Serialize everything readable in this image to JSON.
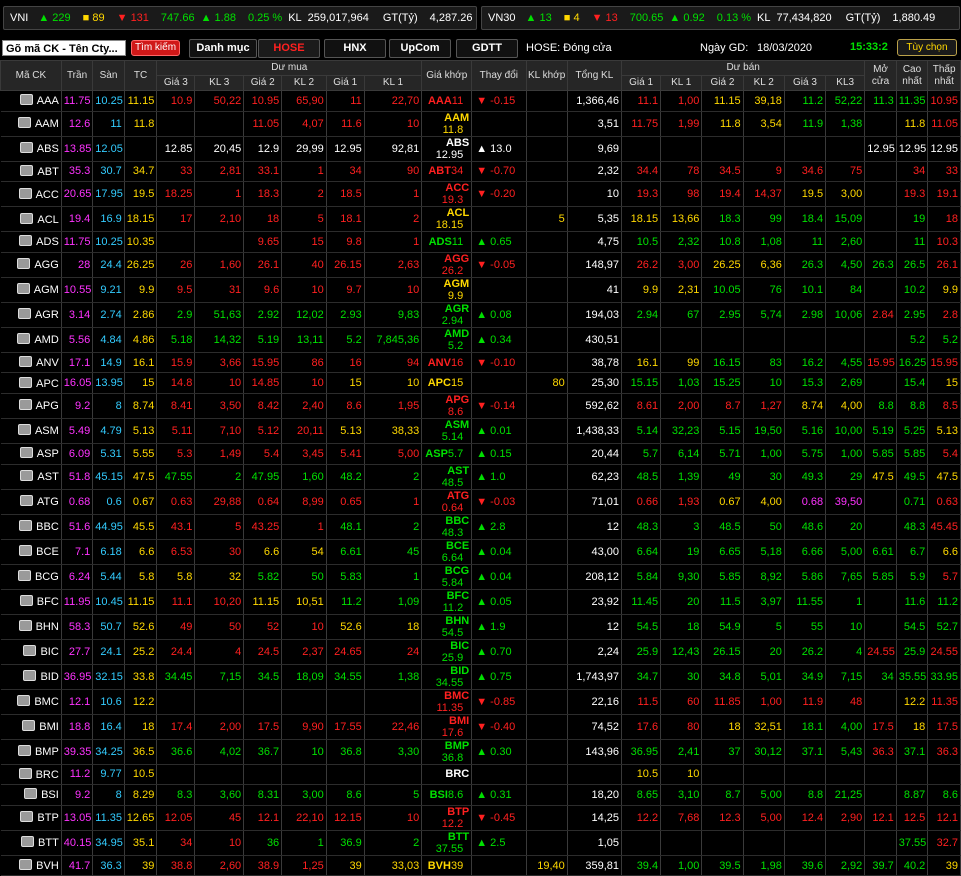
{
  "indices": [
    {
      "name": "VNI",
      "up": "229",
      "ref": "89",
      "down": "131",
      "value": "747.66",
      "change": "1.88",
      "pct": "0.25 %",
      "kl_label": "KL",
      "kl": "259,017,964",
      "gt_label": "GT(Tỷ)",
      "gt": "4,287.26"
    },
    {
      "name": "VN30",
      "up": "13",
      "ref": "4",
      "down": "13",
      "value": "700.65",
      "change": "0.92",
      "pct": "0.13 %",
      "kl_label": "KL",
      "kl": "77,434,820",
      "gt_label": "GT(Tỷ)",
      "gt": "1,880.49"
    }
  ],
  "toolbar": {
    "search_placeholder": "Gõ mã CK - Tên Cty...",
    "search_button": "Tìm kiếm",
    "tabs": [
      "Danh mục",
      "HOSE",
      "HNX",
      "UpCom",
      "GDTT"
    ],
    "active_tab": "HOSE",
    "market_status": "HOSE:  Đóng cửa",
    "date_label": "Ngày GD:",
    "date": "18/03/2020",
    "clock": "15:33:2",
    "custom_button": "Tùy chọn"
  },
  "headers": {
    "symbol": "Mã CK",
    "ceil": "Trần",
    "floor": "Sàn",
    "ref": "TC",
    "buy_group": "Dư mua",
    "match_group": "Giá khớp",
    "change": "Thay đổi",
    "match_vol": "KL khớp",
    "total_vol": "Tổng KL",
    "sell_group": "Dư bán",
    "open": "Mở cửa",
    "high": "Cao nhất",
    "low": "Thấp nhất",
    "buy_cols": [
      "Giá 3",
      "KL 3",
      "Giá 2",
      "KL 2",
      "Giá 1",
      "KL 1"
    ],
    "sell_cols": [
      "Giá 1",
      "KL 1",
      "Giá 2",
      "KL 2",
      "Giá 3",
      "KL3"
    ]
  },
  "colors": {
    "ceil": "#ff33ff",
    "floor": "#33ccff",
    "ref": "#ffd800",
    "up": "#00e000",
    "down": "#ff2020",
    "header_bg": "#262626"
  },
  "rows": [
    [
      "AAA",
      "11.75",
      "10.25",
      "11.15",
      "10.9",
      "50,22",
      "10.95",
      "65,90",
      "11",
      "22,70",
      "11",
      "-0.15",
      "",
      "1,366,46",
      "11.1",
      "1,00",
      "11.15",
      "39,18",
      "11.2",
      "52,22",
      "11.3",
      "11.35",
      "10.95"
    ],
    [
      "AAM",
      "12.6",
      "11",
      "11.8",
      "",
      "",
      "11.05",
      "4,07",
      "11.6",
      "10",
      "11.8",
      "",
      "",
      "3,51",
      "11.75",
      "1,99",
      "11.8",
      "3,54",
      "11.9",
      "1,38",
      "",
      "11.8",
      "11.05"
    ],
    [
      "ABS",
      "13.85",
      "12.05",
      "",
      "12.85",
      "20,45",
      "12.9",
      "29,99",
      "12.95",
      "92,81",
      "12.95",
      "13.0",
      "",
      "9,69",
      "",
      "",
      "",
      "",
      "",
      "",
      "12.95",
      "12.95",
      "12.95"
    ],
    [
      "ABT",
      "35.3",
      "30.7",
      "34.7",
      "33",
      "2,81",
      "33.1",
      "1",
      "34",
      "90",
      "34",
      "-0.70",
      "",
      "2,32",
      "34.4",
      "78",
      "34.5",
      "9",
      "34.6",
      "75",
      "",
      "34",
      "33"
    ],
    [
      "ACC",
      "20.65",
      "17.95",
      "19.5",
      "18.25",
      "1",
      "18.3",
      "2",
      "18.5",
      "1",
      "19.3",
      "-0.20",
      "",
      "10",
      "19.3",
      "98",
      "19.4",
      "14,37",
      "19.5",
      "3,00",
      "",
      "19.3",
      "19.1"
    ],
    [
      "ACL",
      "19.4",
      "16.9",
      "18.15",
      "17",
      "2,10",
      "18",
      "5",
      "18.1",
      "2",
      "18.15",
      "",
      "5",
      "5,35",
      "18.15",
      "13,66",
      "18.3",
      "99",
      "18.4",
      "15,09",
      "",
      "19",
      "18"
    ],
    [
      "ADS",
      "11.75",
      "10.25",
      "10.35",
      "",
      "",
      "9.65",
      "15",
      "9.8",
      "1",
      "11",
      "0.65",
      "",
      "4,75",
      "10.5",
      "2,32",
      "10.8",
      "1,08",
      "11",
      "2,60",
      "",
      "11",
      "10.3"
    ],
    [
      "AGG",
      "28",
      "24.4",
      "26.25",
      "26",
      "1,60",
      "26.1",
      "40",
      "26.15",
      "2,63",
      "26.2",
      "-0.05",
      "",
      "148,97",
      "26.2",
      "3,00",
      "26.25",
      "6,36",
      "26.3",
      "4,50",
      "26.3",
      "26.5",
      "26.1"
    ],
    [
      "AGM",
      "10.55",
      "9.21",
      "9.9",
      "9.5",
      "31",
      "9.6",
      "10",
      "9.7",
      "10",
      "9.9",
      "",
      "",
      "41",
      "9.9",
      "2,31",
      "10.05",
      "76",
      "10.1",
      "84",
      "",
      "10.2",
      "9.9"
    ],
    [
      "AGR",
      "3.14",
      "2.74",
      "2.86",
      "2.9",
      "51,63",
      "2.92",
      "12,02",
      "2.93",
      "9,83",
      "2.94",
      "0.08",
      "",
      "194,03",
      "2.94",
      "67",
      "2.95",
      "5,74",
      "2.98",
      "10,06",
      "2.84",
      "2.95",
      "2.8"
    ],
    [
      "AMD",
      "5.56",
      "4.84",
      "4.86",
      "5.18",
      "14,32",
      "5.19",
      "13,11",
      "5.2",
      "7,845,36",
      "5.2",
      "0.34",
      "",
      "430,51",
      "",
      "",
      "",
      "",
      "",
      "",
      "",
      "5.2",
      "5.2"
    ],
    [
      "ANV",
      "17.1",
      "14.9",
      "16.1",
      "15.9",
      "3,66",
      "15.95",
      "86",
      "16",
      "94",
      "16",
      "-0.10",
      "",
      "38,78",
      "16.1",
      "99",
      "16.15",
      "83",
      "16.2",
      "4,55",
      "15.95",
      "16.25",
      "15.95"
    ],
    [
      "APC",
      "16.05",
      "13.95",
      "15",
      "14.8",
      "10",
      "14.85",
      "10",
      "15",
      "10",
      "15",
      "",
      "80",
      "25,30",
      "15.15",
      "1,03",
      "15.25",
      "10",
      "15.3",
      "2,69",
      "",
      "15.4",
      "15"
    ],
    [
      "APG",
      "9.2",
      "8",
      "8.74",
      "8.41",
      "3,50",
      "8.42",
      "2,40",
      "8.6",
      "1,95",
      "8.6",
      "-0.14",
      "",
      "592,62",
      "8.61",
      "2,00",
      "8.7",
      "1,27",
      "8.74",
      "4,00",
      "8.8",
      "8.8",
      "8.5"
    ],
    [
      "ASM",
      "5.49",
      "4.79",
      "5.13",
      "5.11",
      "7,10",
      "5.12",
      "20,11",
      "5.13",
      "38,33",
      "5.14",
      "0.01",
      "",
      "1,438,33",
      "5.14",
      "32,23",
      "5.15",
      "19,50",
      "5.16",
      "10,00",
      "5.19",
      "5.25",
      "5.13"
    ],
    [
      "ASP",
      "6.09",
      "5.31",
      "5.55",
      "5.3",
      "1,49",
      "5.4",
      "3,45",
      "5.41",
      "5,00",
      "5.7",
      "0.15",
      "",
      "20,44",
      "5.7",
      "6,14",
      "5.71",
      "1,00",
      "5.75",
      "1,00",
      "5.85",
      "5.85",
      "5.4"
    ],
    [
      "AST",
      "51.8",
      "45.15",
      "47.5",
      "47.55",
      "2",
      "47.95",
      "1,60",
      "48.2",
      "2",
      "48.5",
      "1.0",
      "",
      "62,23",
      "48.5",
      "1,39",
      "49",
      "30",
      "49.3",
      "29",
      "47.5",
      "49.5",
      "47.5"
    ],
    [
      "ATG",
      "0.68",
      "0.6",
      "0.67",
      "0.63",
      "29,88",
      "0.64",
      "8,99",
      "0.65",
      "1",
      "0.64",
      "-0.03",
      "",
      "71,01",
      "0.66",
      "1,93",
      "0.67",
      "4,00",
      "0.68",
      "39,50",
      "",
      "0.71",
      "0.63"
    ],
    [
      "BBC",
      "51.6",
      "44.95",
      "45.5",
      "43.1",
      "5",
      "43.25",
      "1",
      "48.1",
      "2",
      "48.3",
      "2.8",
      "",
      "12",
      "48.3",
      "3",
      "48.5",
      "50",
      "48.6",
      "20",
      "",
      "48.3",
      "45.45"
    ],
    [
      "BCE",
      "7.1",
      "6.18",
      "6.6",
      "6.53",
      "30",
      "6.6",
      "54",
      "6.61",
      "45",
      "6.64",
      "0.04",
      "",
      "43,00",
      "6.64",
      "19",
      "6.65",
      "5,18",
      "6.66",
      "5,00",
      "6.61",
      "6.7",
      "6.6"
    ],
    [
      "BCG",
      "6.24",
      "5.44",
      "5.8",
      "5.8",
      "32",
      "5.82",
      "50",
      "5.83",
      "1",
      "5.84",
      "0.04",
      "",
      "208,12",
      "5.84",
      "9,30",
      "5.85",
      "8,92",
      "5.86",
      "7,65",
      "5.85",
      "5.9",
      "5.7"
    ],
    [
      "BFC",
      "11.95",
      "10.45",
      "11.15",
      "11.1",
      "10,20",
      "11.15",
      "10,51",
      "11.2",
      "1,09",
      "11.2",
      "0.05",
      "",
      "23,92",
      "11.45",
      "20",
      "11.5",
      "3,97",
      "11.55",
      "1",
      "",
      "11.6",
      "11.2"
    ],
    [
      "BHN",
      "58.3",
      "50.7",
      "52.6",
      "49",
      "50",
      "52",
      "10",
      "52.6",
      "18",
      "54.5",
      "1.9",
      "",
      "12",
      "54.5",
      "18",
      "54.9",
      "5",
      "55",
      "10",
      "",
      "54.5",
      "52.7"
    ],
    [
      "BIC",
      "27.7",
      "24.1",
      "25.2",
      "24.4",
      "4",
      "24.5",
      "2,37",
      "24.65",
      "24",
      "25.9",
      "0.70",
      "",
      "2,24",
      "25.9",
      "12,43",
      "26.15",
      "20",
      "26.2",
      "4",
      "24.55",
      "25.9",
      "24.55"
    ],
    [
      "BID",
      "36.95",
      "32.15",
      "33.8",
      "34.45",
      "7,15",
      "34.5",
      "18,09",
      "34.55",
      "1,38",
      "34.55",
      "0.75",
      "",
      "1,743,97",
      "34.7",
      "30",
      "34.8",
      "5,01",
      "34.9",
      "7,15",
      "34",
      "35.55",
      "33.95"
    ],
    [
      "BMC",
      "12.1",
      "10.6",
      "12.2",
      "",
      "",
      "",
      "",
      "",
      "",
      "11.35",
      "-0.85",
      "",
      "22,16",
      "11.5",
      "60",
      "11.85",
      "1,00",
      "11.9",
      "48",
      "",
      "12.2",
      "11.35"
    ],
    [
      "BMI",
      "18.8",
      "16.4",
      "18",
      "17.4",
      "2,00",
      "17.5",
      "9,90",
      "17.55",
      "22,46",
      "17.6",
      "-0.40",
      "",
      "74,52",
      "17.6",
      "80",
      "18",
      "32,51",
      "18.1",
      "4,00",
      "17.5",
      "18",
      "17.5"
    ],
    [
      "BMP",
      "39.35",
      "34.25",
      "36.5",
      "36.6",
      "4,02",
      "36.7",
      "10",
      "36.8",
      "3,30",
      "36.8",
      "0.30",
      "",
      "143,96",
      "36.95",
      "2,41",
      "37",
      "30,12",
      "37.1",
      "5,43",
      "36.3",
      "37.1",
      "36.3"
    ],
    [
      "BRC",
      "11.2",
      "9.77",
      "10.5",
      "",
      "",
      "",
      "",
      "",
      "",
      "",
      "",
      "",
      "",
      "10.5",
      "10",
      "",
      "",
      "",
      "",
      "",
      "",
      ""
    ],
    [
      "BSI",
      "9.2",
      "8",
      "8.29",
      "8.3",
      "3,60",
      "8.31",
      "3,00",
      "8.6",
      "5",
      "8.6",
      "0.31",
      "",
      "18,20",
      "8.65",
      "3,10",
      "8.7",
      "5,00",
      "8.8",
      "21,25",
      "",
      "8.87",
      "8.6"
    ],
    [
      "BTP",
      "13.05",
      "11.35",
      "12.65",
      "12.05",
      "45",
      "12.1",
      "22,10",
      "12.15",
      "10",
      "12.2",
      "-0.45",
      "",
      "14,25",
      "12.2",
      "7,68",
      "12.3",
      "5,00",
      "12.4",
      "2,90",
      "12.1",
      "12.5",
      "12.1"
    ],
    [
      "BTT",
      "40.15",
      "34.95",
      "35.1",
      "34",
      "10",
      "36",
      "1",
      "36.9",
      "2",
      "37.55",
      "2.5",
      "",
      "1,05",
      "",
      "",
      "",
      "",
      "",
      "",
      "",
      "37.55",
      "32.7"
    ],
    [
      "BVH",
      "41.7",
      "36.3",
      "39",
      "38.8",
      "2,60",
      "38.9",
      "1,25",
      "39",
      "33,03",
      "39",
      "",
      "19,40",
      "359,81",
      "39.4",
      "1,00",
      "39.5",
      "1,98",
      "39.6",
      "2,92",
      "39.7",
      "40.2",
      "39"
    ]
  ]
}
